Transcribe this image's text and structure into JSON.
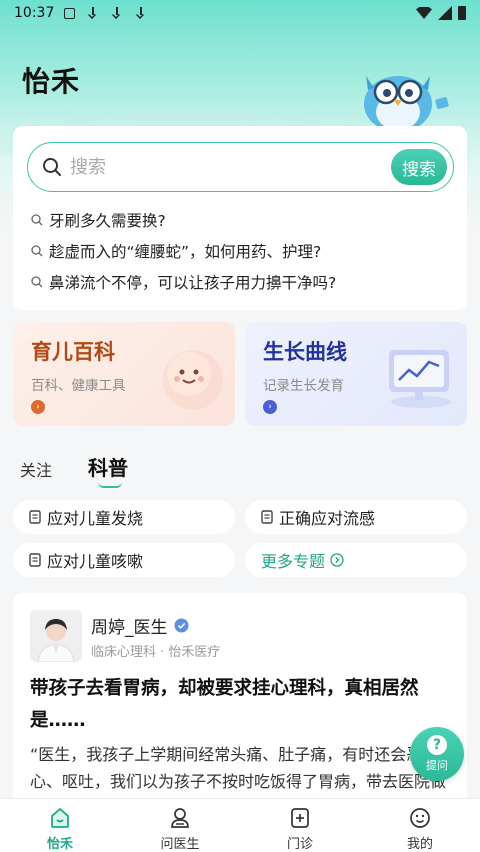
{
  "status_bar": {
    "time": "10:37"
  },
  "app_title": "怡禾",
  "search": {
    "placeholder": "搜索",
    "button": "搜索"
  },
  "suggestions": [
    "牙刷多久需要换?",
    "趁虚而入的“缠腰蛇”，如何用药、护理?",
    "鼻涕流个不停，可以让孩子用力擤干净吗?"
  ],
  "features": [
    {
      "title": "育儿百科",
      "subtitle": "百科、健康工具"
    },
    {
      "title": "生长曲线",
      "subtitle": "记录生长发育"
    }
  ],
  "tabs": [
    {
      "label": "关注",
      "active": false
    },
    {
      "label": "科普",
      "active": true
    }
  ],
  "topics": [
    "应对儿童发烧",
    "正确应对流感",
    "应对儿童咳嗽"
  ],
  "more_topics": "更多专题",
  "article": {
    "author": "周婷_医生",
    "info": "临床心理科 · 怡禾医疗",
    "title": "带孩子去看胃病，却被要求挂心理科，真相居然是……",
    "excerpt": "“医生，我孩子上学期间经常头痛、肚子痛，有时还会恶心、呕吐，我们以为孩子不按时吃饭得了胃病，带去医院做了全身检查也没发现明显的问题……"
  },
  "ask_button": "提问",
  "nav": [
    {
      "label": "怡禾",
      "icon": "home-icon",
      "active": true
    },
    {
      "label": "问医生",
      "icon": "doctor-icon",
      "active": false
    },
    {
      "label": "门诊",
      "icon": "clinic-icon",
      "active": false
    },
    {
      "label": "我的",
      "icon": "profile-icon",
      "active": false
    }
  ],
  "colors": {
    "accent": "#2fbf9f",
    "encyclopedia": "#b34a16",
    "growth": "#24329c"
  }
}
